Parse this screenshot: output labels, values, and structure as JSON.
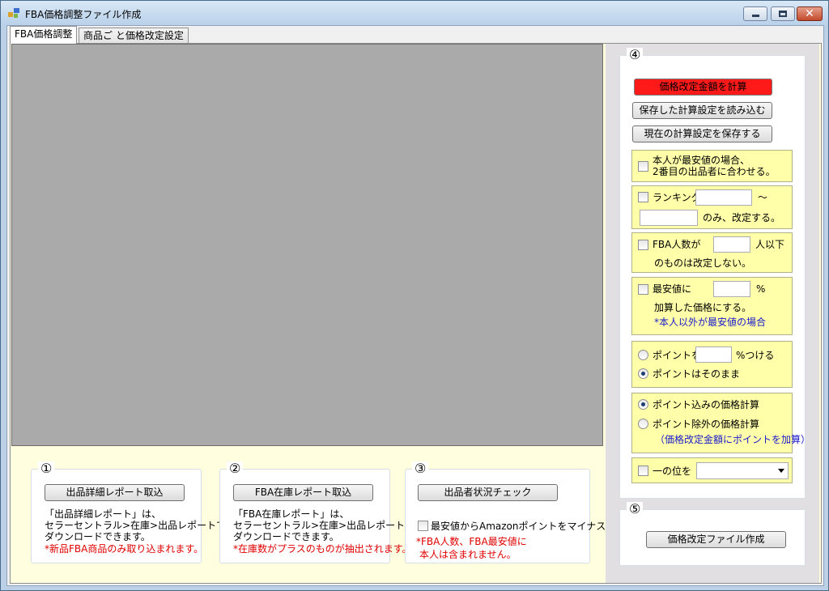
{
  "window": {
    "title": "FBA価格調整ファイル作成",
    "icon": "app-icon"
  },
  "tabs": [
    {
      "label": "FBA価格調整",
      "active": true
    },
    {
      "label": "商品ご と価格改定設定",
      "active": false
    }
  ],
  "bottom_groups": [
    {
      "number": "①",
      "button": "出品詳細レポート取込",
      "lines": [
        "「出品詳細レポート」は、",
        "セラーセントラル>在庫>出品レポートで、",
        "ダウンロードできます。"
      ],
      "note": "*新品FBA商品のみ取り込まれます。"
    },
    {
      "number": "②",
      "button": "FBA在庫レポート取込",
      "lines": [
        "「FBA在庫レポート」は、",
        "セラーセントラル>在庫>出品レポートで、",
        "ダウンロードできます。"
      ],
      "note": "*在庫数がプラスのものが抽出されます。"
    },
    {
      "number": "③",
      "button": "出品者状況チェック",
      "checkbox_label": "最安値からAmazonポイントをマイナス",
      "note_lines": [
        "*FBA人数、FBA最安値に",
        "本人は含まれません。"
      ]
    }
  ],
  "right": {
    "group4": {
      "number": "④",
      "calc_button": "価格改定金額を計算",
      "load_button": "保存した計算設定を読み込む",
      "save_button": "現在の計算設定を保存する",
      "opt_lowest": [
        "本人が最安値の場合、",
        "2番目の出品者に合わせる。"
      ],
      "opt_ranking": {
        "label": "ランキング",
        "tilde": "～",
        "suffix": "のみ、改定する。",
        "from": "",
        "to": ""
      },
      "opt_fba": {
        "label": "FBA人数が",
        "suffix": "人以下",
        "line2": "のものは改定しない。",
        "value": ""
      },
      "opt_markup": {
        "label": "最安値に",
        "unit": "%",
        "line2": "加算した価格にする。",
        "note": "*本人以外が最安値の場合",
        "value": ""
      },
      "points": {
        "opt1": "ポイントを",
        "opt1_suffix": "%つける",
        "opt2": "ポイントはそのまま",
        "value": ""
      },
      "calc_mode": {
        "opt1": "ポイント込みの価格計算",
        "opt2": "ポイント除外の価格計算",
        "note": "（価格改定金額にポイントを加算）"
      },
      "ones_digit": {
        "label": "一の位を",
        "selected": ""
      }
    },
    "group5": {
      "number": "⑤",
      "create_button": "価格改定ファイル作成"
    }
  },
  "colors": {
    "tab_background": "#ffffdf",
    "grid_background": "#abaaab",
    "option_background": "#ffffaa",
    "calc_button": "#ff1a1a",
    "note_text": "#e00000"
  }
}
